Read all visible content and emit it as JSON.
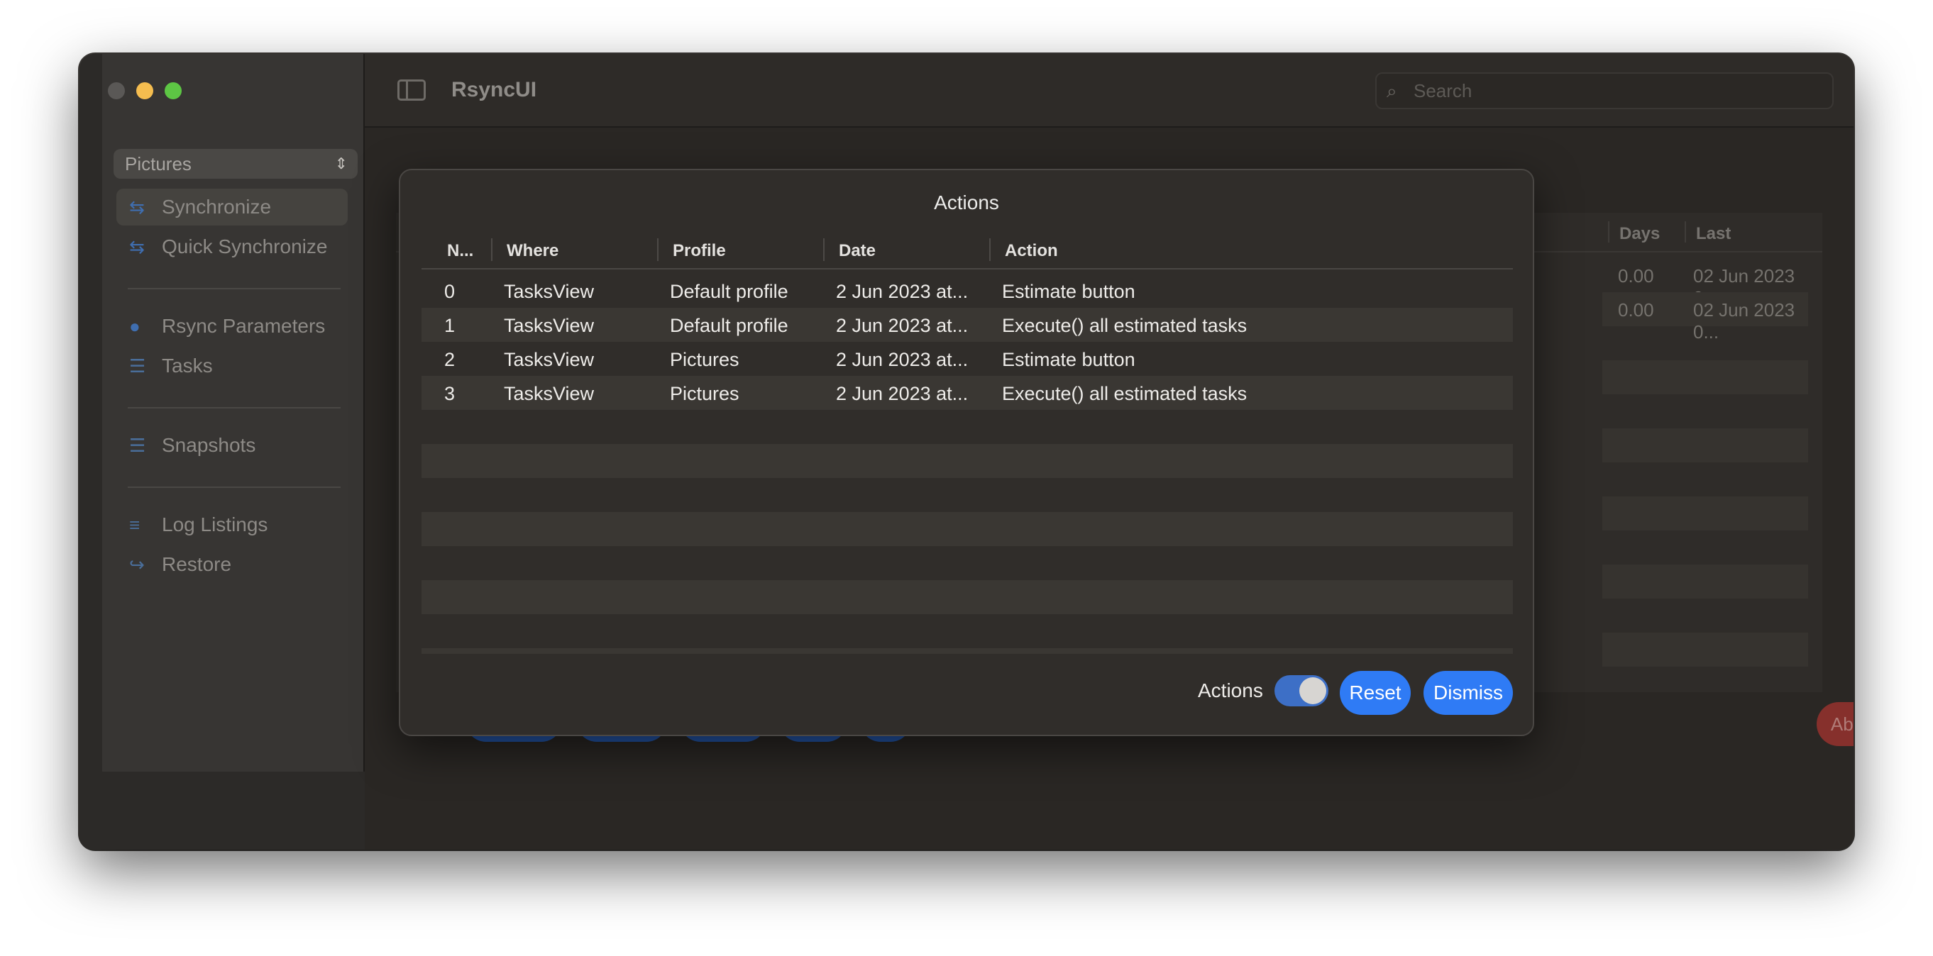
{
  "app": {
    "title": "RsyncUI"
  },
  "search": {
    "placeholder": "Search"
  },
  "sidebar": {
    "profile": "Pictures",
    "items": [
      {
        "label": "Synchronize",
        "icon": "sync-icon"
      },
      {
        "label": "Quick Synchronize",
        "icon": "quick-sync-icon"
      },
      {
        "label": "Rsync Parameters",
        "icon": "rsync-parameters-icon"
      },
      {
        "label": "Tasks",
        "icon": "tasks-icon"
      },
      {
        "label": "Snapshots",
        "icon": "snapshots-icon"
      },
      {
        "label": "Log Listings",
        "icon": "log-listings-icon"
      },
      {
        "label": "Restore",
        "icon": "restore-icon"
      }
    ]
  },
  "background_table": {
    "columns": [
      "Days",
      "Last"
    ],
    "rows": [
      {
        "days": "0.00",
        "last": "02 Jun 2023 0..."
      },
      {
        "days": "0.00",
        "last": "02 Jun 2023 0..."
      }
    ]
  },
  "abort_label": "Abort",
  "sheet": {
    "title": "Actions",
    "columns": [
      "N...",
      "Where",
      "Profile",
      "Date",
      "Action"
    ],
    "rows": [
      {
        "n": "0",
        "where": "TasksView",
        "profile": "Default profile",
        "date": "2 Jun 2023 at...",
        "action": "Estimate button"
      },
      {
        "n": "1",
        "where": "TasksView",
        "profile": "Default profile",
        "date": "2 Jun 2023 at...",
        "action": "Execute() all estimated tasks"
      },
      {
        "n": "2",
        "where": "TasksView",
        "profile": "Pictures",
        "date": "2 Jun 2023 at...",
        "action": "Estimate button"
      },
      {
        "n": "3",
        "where": "TasksView",
        "profile": "Pictures",
        "date": "2 Jun 2023 at...",
        "action": "Execute() all estimated tasks"
      }
    ],
    "toggle_label": "Actions",
    "toggle_on": true,
    "reset_label": "Reset",
    "dismiss_label": "Dismiss"
  },
  "colors": {
    "accent": "#2f7bf5",
    "abort": "#86302c",
    "window_bg": "#2a2724"
  }
}
